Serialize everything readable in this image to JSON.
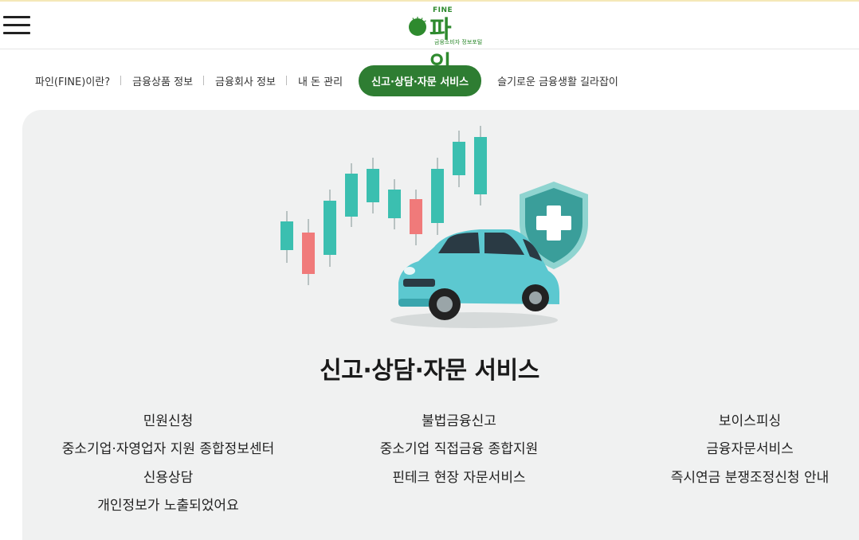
{
  "header": {
    "logo": {
      "fine_label": "FINE",
      "name": "파 인",
      "subtitle": "금융소비자 정보포털"
    },
    "menu_icon": "hamburger-menu-icon"
  },
  "nav": {
    "items": [
      {
        "label": "파인(FINE)이란?"
      },
      {
        "label": "금융상품 정보"
      },
      {
        "label": "금융회사 정보"
      },
      {
        "label": "내 돈 관리"
      },
      {
        "label": "신고·상담·자문 서비스",
        "active": true
      },
      {
        "label": "슬기로운 금융생활 길라잡이"
      }
    ]
  },
  "colors": {
    "brand_green": "#2e7d32",
    "panel_bg": "#f0f1f1",
    "car_teal": "#5cc8d0",
    "candle_teal": "#3bbfb0",
    "candle_red": "#f07a7a"
  },
  "section": {
    "title": "신고·상담·자문 서비스",
    "hero_image": "car-with-shield-and-candlestick-chart-illustration",
    "columns": [
      [
        "민원신청",
        "중소기업·자영업자 지원 종합정보센터",
        "신용상담",
        "개인정보가 노출되었어요"
      ],
      [
        "불법금융신고",
        "중소기업 직접금융 종합지원",
        "핀테크 현장 자문서비스"
      ],
      [
        "보이스피싱",
        "금융자문서비스",
        "즉시연금 분쟁조정신청 안내"
      ]
    ]
  }
}
